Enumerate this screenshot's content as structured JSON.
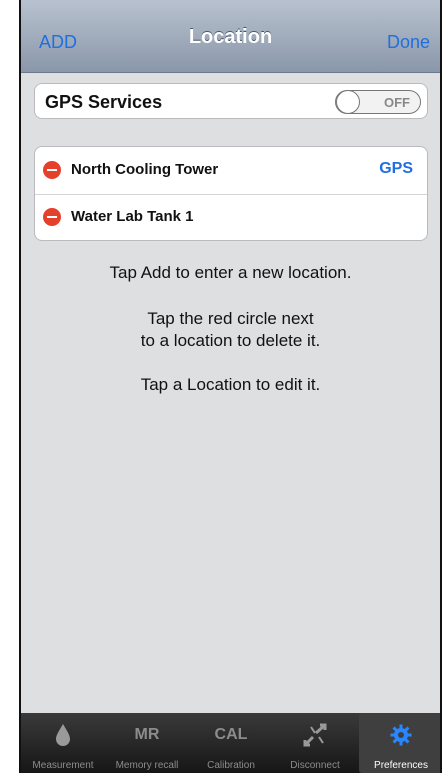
{
  "nav": {
    "left_button": "ADD",
    "title": "Location",
    "right_button": "Done"
  },
  "gps": {
    "label": "GPS Services",
    "toggle_state": "OFF"
  },
  "locations": [
    {
      "name": "North Cooling Tower",
      "accessory": "GPS"
    },
    {
      "name": "Water Lab Tank 1",
      "accessory": ""
    }
  ],
  "help": {
    "line1": "Tap Add to enter a new location.",
    "line2a": "Tap the red circle next",
    "line2b": "to a location to delete it.",
    "line3": "Tap a Location to edit it."
  },
  "tabs": [
    {
      "label": "Measurement",
      "icon": "droplet-icon",
      "icon_text": ""
    },
    {
      "label": "Memory recall",
      "icon": "mr-icon",
      "icon_text": "MR"
    },
    {
      "label": "Calibration",
      "icon": "cal-icon",
      "icon_text": "CAL"
    },
    {
      "label": "Disconnect",
      "icon": "disconnect-icon",
      "icon_text": ""
    },
    {
      "label": "Preferences",
      "icon": "gear-icon",
      "icon_text": ""
    }
  ],
  "colors": {
    "accent": "#1f6fe0",
    "delete": "#e5402b",
    "selected_tab_icon": "#2a86ff"
  }
}
